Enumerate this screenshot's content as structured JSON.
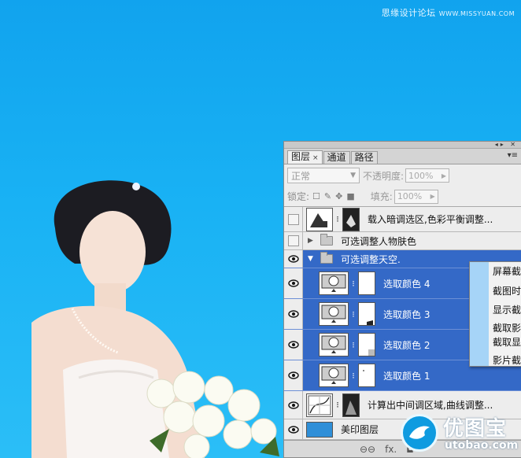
{
  "watermark": {
    "cn": "思缘设计论坛",
    "site": "WWW.MISSYUAN.COM"
  },
  "panel": {
    "tabs": [
      {
        "label": "图层",
        "close": "×"
      },
      {
        "label": "通道"
      },
      {
        "label": "路径"
      }
    ],
    "blend_mode": "正常",
    "opacity_label": "不透明度:",
    "opacity_value": "100%",
    "lock_label": "锁定:",
    "fill_label": "填充:",
    "fill_value": "100%",
    "layers": [
      {
        "name": "载入暗调选区,色彩平衡调整...",
        "visible": false,
        "selected": false
      },
      {
        "name": "可选调整人物肤色",
        "visible": false,
        "selected": false,
        "type": "group-collapsed"
      },
      {
        "name": "可选调整天空.",
        "visible": true,
        "selected": true,
        "type": "group-expanded"
      },
      {
        "name": "选取颜色 4",
        "visible": true,
        "selected": true
      },
      {
        "name": "选取颜色 3",
        "visible": true,
        "selected": true
      },
      {
        "name": "选取颜色 2",
        "visible": true,
        "selected": true
      },
      {
        "name": "选取颜色 1",
        "visible": true,
        "selected": true
      },
      {
        "name": "计算出中间调区域,曲线调整...",
        "visible": true,
        "selected": false
      },
      {
        "name": "美印图层",
        "visible": true,
        "selected": false
      }
    ],
    "bottom_icons": [
      "link-icon",
      "fx-icon",
      "mask-icon"
    ],
    "fx_label": "fx."
  },
  "context_menu": {
    "items": [
      "屏幕截",
      "截图时",
      "显示截",
      "截取影",
      "截取显",
      "影片截"
    ]
  },
  "logo": {
    "cn": "优图宝",
    "en": "utobao.com"
  },
  "colors": {
    "sky": "#19b2f4",
    "selection": "#3469c7",
    "panel_bg": "#ededed",
    "menu_strip": "#a6d4f7"
  }
}
